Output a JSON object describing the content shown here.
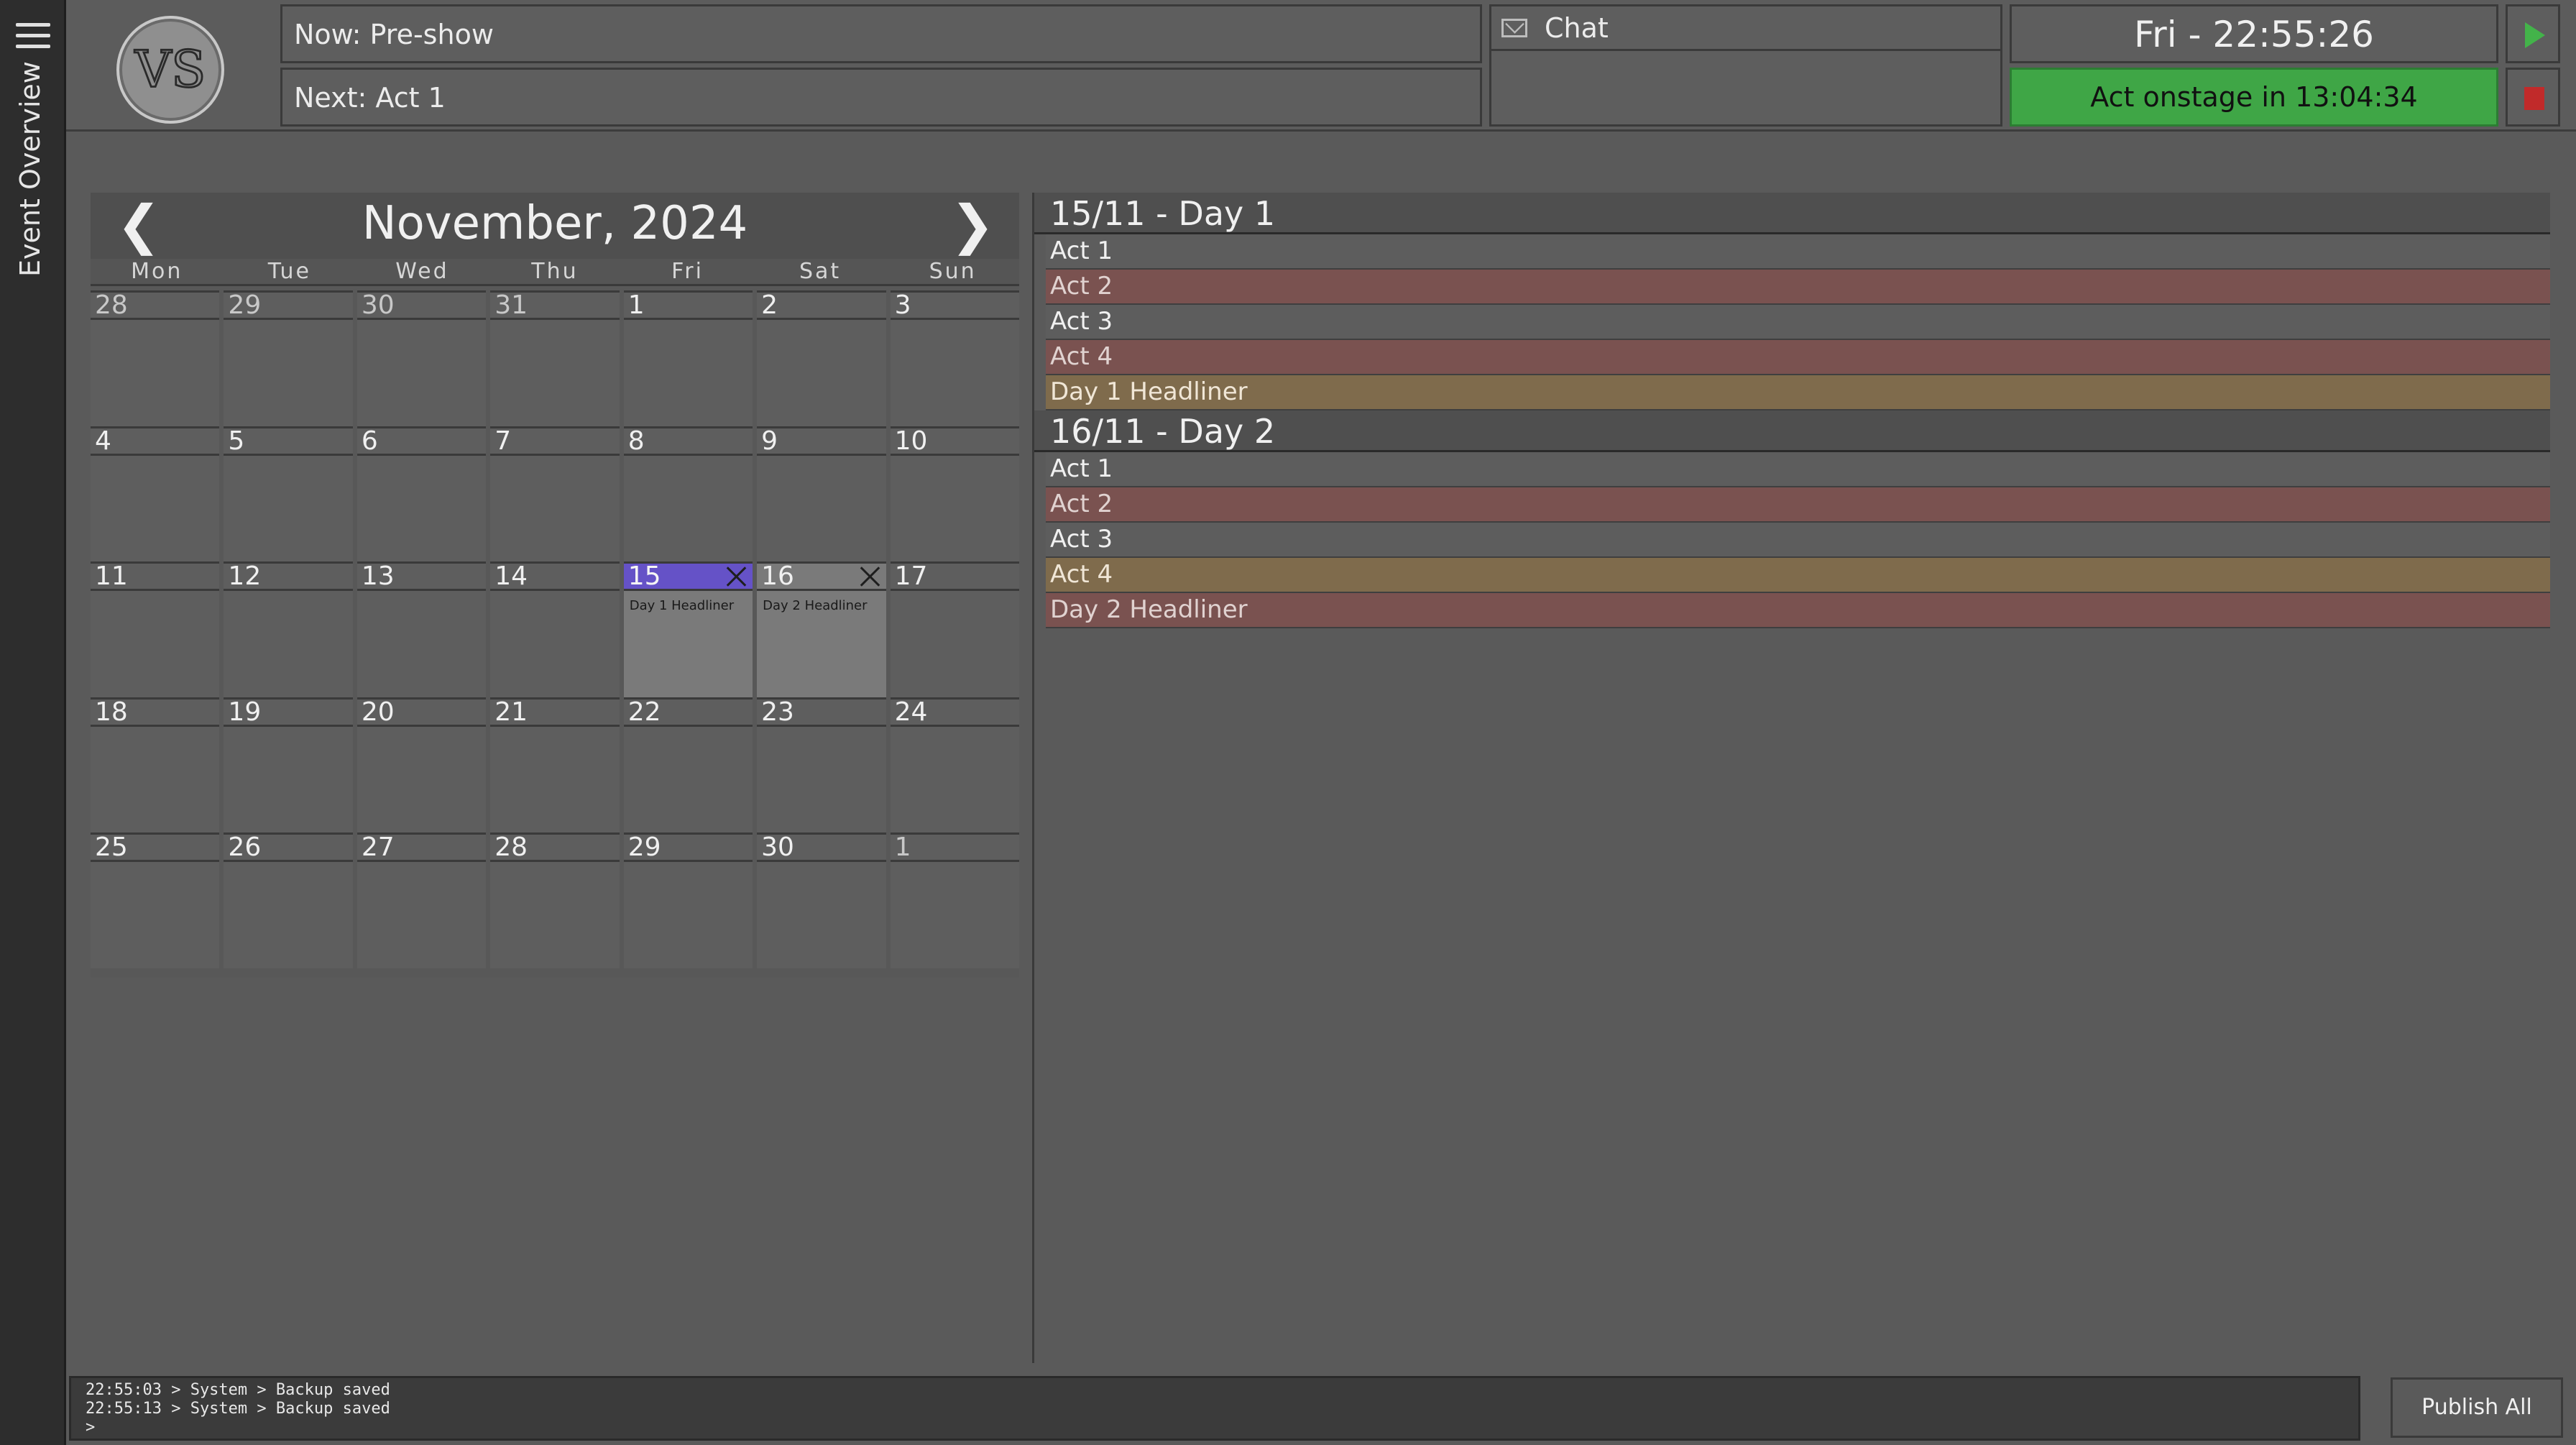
{
  "sidebar": {
    "menu_icon": "hamburger-icon",
    "label": "Event Overview"
  },
  "header": {
    "logo_text": "VS",
    "now": "Now: Pre-show",
    "next": "Next: Act 1",
    "chat_icon": "mail-icon",
    "chat_label": "Chat",
    "clock": "Fri - 22:55:26",
    "onstage": "Act onstage in 13:04:34",
    "play_icon": "play-icon",
    "stop_icon": "stop-icon",
    "colors": {
      "onstage": "#3fa646",
      "play": "#43b34a",
      "stop": "#c12a2a"
    }
  },
  "calendar": {
    "title": "November, 2024",
    "prev_icon": "chevron-left-icon",
    "next_icon": "chevron-right-icon",
    "prev_glyph": "❮",
    "next_glyph": "❯",
    "weekdays": [
      "Mon",
      "Tue",
      "Wed",
      "Thu",
      "Fri",
      "Sat",
      "Sun"
    ],
    "days": [
      {
        "n": "28",
        "other": true
      },
      {
        "n": "29",
        "other": true
      },
      {
        "n": "30",
        "other": true
      },
      {
        "n": "31",
        "other": true
      },
      {
        "n": "1"
      },
      {
        "n": "2"
      },
      {
        "n": "3"
      },
      {
        "n": "4"
      },
      {
        "n": "5"
      },
      {
        "n": "6"
      },
      {
        "n": "7"
      },
      {
        "n": "8"
      },
      {
        "n": "9"
      },
      {
        "n": "10"
      },
      {
        "n": "11"
      },
      {
        "n": "12"
      },
      {
        "n": "13"
      },
      {
        "n": "14"
      },
      {
        "n": "15",
        "selected": true,
        "event": "Day 1 Headliner"
      },
      {
        "n": "16",
        "event": "Day 2 Headliner"
      },
      {
        "n": "17"
      },
      {
        "n": "18"
      },
      {
        "n": "19"
      },
      {
        "n": "20"
      },
      {
        "n": "21"
      },
      {
        "n": "22"
      },
      {
        "n": "23"
      },
      {
        "n": "24"
      },
      {
        "n": "25"
      },
      {
        "n": "26"
      },
      {
        "n": "27"
      },
      {
        "n": "28"
      },
      {
        "n": "29"
      },
      {
        "n": "30"
      },
      {
        "n": "1",
        "other": true
      }
    ],
    "selected_color": "#6552c7"
  },
  "schedule": [
    {
      "title": "15/11 - Day 1",
      "acts": [
        {
          "name": "Act 1",
          "color": "grey"
        },
        {
          "name": "Act 2",
          "color": "red"
        },
        {
          "name": "Act 3",
          "color": "grey"
        },
        {
          "name": "Act 4",
          "color": "red"
        },
        {
          "name": "Day 1 Headliner",
          "color": "gold"
        }
      ]
    },
    {
      "title": "16/11 - Day 2",
      "acts": [
        {
          "name": "Act 1",
          "color": "grey"
        },
        {
          "name": "Act 2",
          "color": "red"
        },
        {
          "name": "Act 3",
          "color": "grey"
        },
        {
          "name": "Act 4",
          "color": "gold"
        },
        {
          "name": "Day 2 Headliner",
          "color": "red"
        }
      ]
    }
  ],
  "console": {
    "lines": [
      "22:55:03 > System > Backup saved",
      "22:55:13 > System > Backup saved"
    ],
    "prompt": ">"
  },
  "publish_label": "Publish All"
}
